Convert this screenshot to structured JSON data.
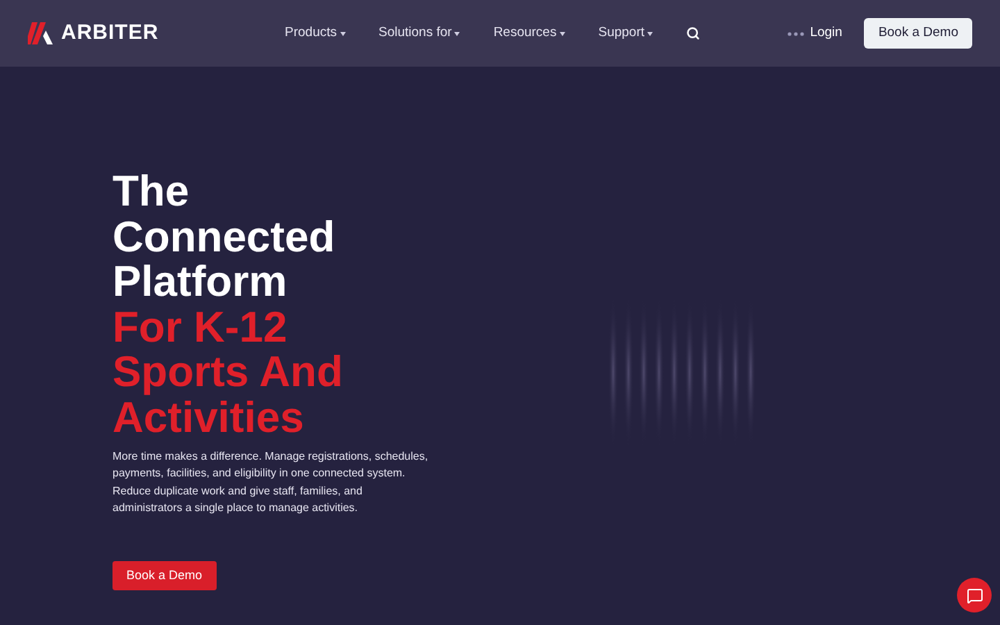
{
  "logo": {
    "text": "ARBITER"
  },
  "nav": [
    {
      "label": "Products",
      "dropdown": true
    },
    {
      "label": "Solutions for",
      "dropdown": true
    },
    {
      "label": "Resources",
      "dropdown": true
    },
    {
      "label": "Support",
      "dropdown": true
    }
  ],
  "login": "Login",
  "header_button": "Book a Demo",
  "hero": {
    "title_lines": [
      "The",
      "Connected",
      "Platform"
    ],
    "highlight_lines": [
      "For K-12",
      "Sports And",
      "Activities"
    ],
    "description": "More time makes a difference. Manage registrations, schedules, payments, facilities, and eligibility in one connected system. Reduce duplicate work and give staff, families, and administrators a single place to manage activities.",
    "button": "Book a Demo"
  }
}
